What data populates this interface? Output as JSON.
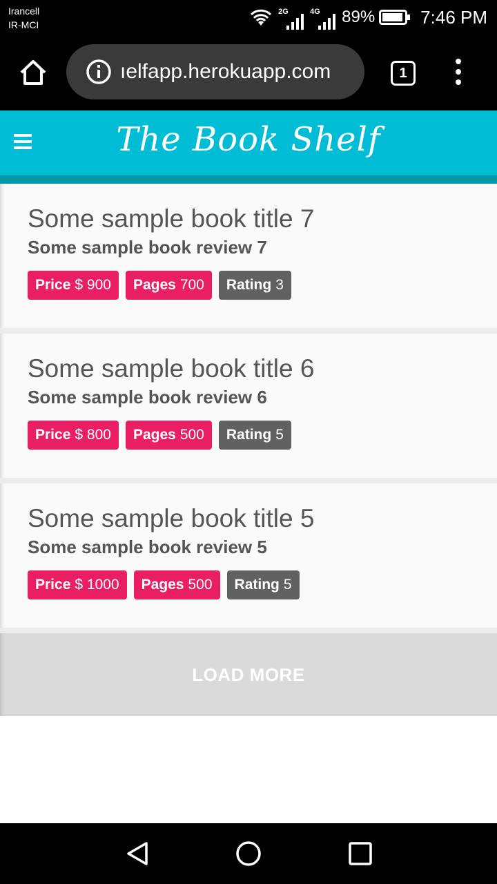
{
  "status_bar": {
    "carrier_line1": "Irancell",
    "carrier_line2": "IR-MCI",
    "sig1_label": "2G",
    "sig2_label": "4G",
    "battery": "89%",
    "time": "7:46 PM"
  },
  "browser": {
    "url": "ıelfapp.herokuapp.com",
    "tab_count": "1",
    "icons": [
      "home-icon",
      "info-icon",
      "tabs-icon",
      "more-vert-icon"
    ]
  },
  "app": {
    "title": "The Book Shelf",
    "header_color": "#00bcd4"
  },
  "labels": {
    "price": "Price",
    "pages": "Pages",
    "rating": "Rating"
  },
  "books": [
    {
      "title": "Some sample book title 7",
      "review": "Some sample book review 7",
      "price": "$ 900",
      "pages": "700",
      "rating": "3"
    },
    {
      "title": "Some sample book title 6",
      "review": "Some sample book review 6",
      "price": "$ 800",
      "pages": "500",
      "rating": "5"
    },
    {
      "title": "Some sample book title 5",
      "review": "Some sample book review 5",
      "price": "$ 1000",
      "pages": "500",
      "rating": "5"
    }
  ],
  "load_more": "LOAD MORE",
  "colors": {
    "badge_pink": "#e91e63",
    "badge_gray": "#616161"
  }
}
